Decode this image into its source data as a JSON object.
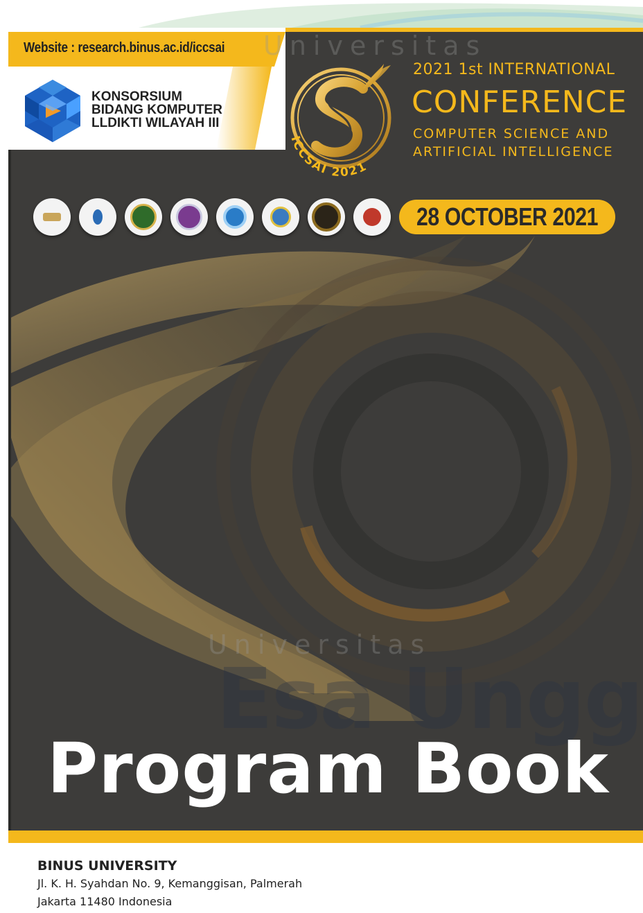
{
  "header": {
    "website": "Website : research.binus.ac.id/iccsai",
    "konsorsium_lines": [
      "KONSORSIUM",
      "BIDANG KOMPUTER",
      "LLDIKTI WILAYAH III"
    ],
    "logo_ring_text": "ICCSAI 2021"
  },
  "conference": {
    "line1": "2021 1st  INTERNATIONAL",
    "line2": "CONFERENCE",
    "line3a": "COMPUTER SCIENCE AND",
    "line3b": "ARTIFICIAL INTELLIGENCE"
  },
  "partners": [
    {
      "name": "partner-logo-1",
      "color": "#c9a55a"
    },
    {
      "name": "partner-logo-2",
      "color": "#2a6bb5"
    },
    {
      "name": "partner-logo-3",
      "color": "#2f6b2a"
    },
    {
      "name": "partner-logo-4",
      "color": "#7a3b8f"
    },
    {
      "name": "partner-logo-5",
      "color": "#2a7cc7"
    },
    {
      "name": "partner-logo-6",
      "color": "#3a7bc0"
    },
    {
      "name": "partner-logo-7",
      "color": "#8b6a1e"
    },
    {
      "name": "partner-logo-8",
      "color": "#c0392b"
    }
  ],
  "date": "28 OCTOBER 2021",
  "title": "Program Book",
  "watermark": {
    "small": "Universitas",
    "big": "Esa Unggul"
  },
  "address": {
    "name": "BINUS UNIVERSITY",
    "line1": "Jl. K. H. Syahdan No. 9, Kemanggisan, Palmerah",
    "line2": "Jakarta 11480 Indonesia"
  },
  "colors": {
    "gold": "#f4b81c",
    "dark": "#3d3c3a"
  }
}
